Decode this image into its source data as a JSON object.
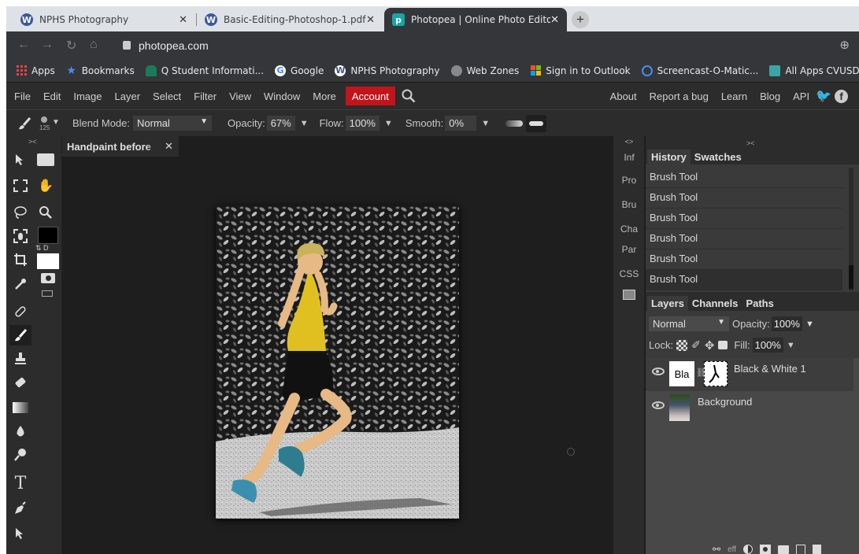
{
  "browser": {
    "tabs": [
      {
        "title": "NPHS Photography",
        "favicon": "W"
      },
      {
        "title": "Basic-Editing-Photoshop-1.pdf",
        "favicon": "W"
      },
      {
        "title": "Photopea | Online Photo Editor",
        "favicon": "p",
        "active": true
      }
    ],
    "new_tab": "+",
    "close": "✕",
    "url": "photopea.com",
    "bookmarks": [
      {
        "label": "Apps",
        "icon": "apps-grid-icon",
        "color": "#e8453c"
      },
      {
        "label": "Bookmarks",
        "icon": "star-icon",
        "color": "#4a8af4"
      },
      {
        "label": "Q Student Informati...",
        "icon": "q-logo-icon",
        "color": "#1c7a5a"
      },
      {
        "label": "Google",
        "icon": "google-icon",
        "color": "#ffffff"
      },
      {
        "label": "NPHS Photography",
        "icon": "wordpress-icon",
        "color": "#ffffff"
      },
      {
        "label": "Web Zones",
        "icon": "globe-icon",
        "color": "#aaaaaa"
      },
      {
        "label": "Sign in to Outlook",
        "icon": "microsoft-icon",
        "color": "#f25022"
      },
      {
        "label": "Screencast-O-Matic...",
        "icon": "screencast-icon",
        "color": "#4a8af4"
      },
      {
        "label": "All Apps CVUSD",
        "icon": "apps-icon",
        "color": "#3aa7a3"
      }
    ]
  },
  "menu": {
    "items": [
      "File",
      "Edit",
      "Image",
      "Layer",
      "Select",
      "Filter",
      "View",
      "Window",
      "More"
    ],
    "account": "Account",
    "right": [
      "About",
      "Report a bug",
      "Learn",
      "Blog",
      "API"
    ]
  },
  "options": {
    "brush_size": "125",
    "blend_label": "Blend Mode:",
    "blend_value": "Normal",
    "opacity_label": "Opacity:",
    "opacity_value": "67%",
    "flow_label": "Flow:",
    "flow_value": "100%",
    "smooth_label": "Smooth:",
    "smooth_value": "0%"
  },
  "document": {
    "tab_title": "Handpaint before",
    "tab_close": "✕"
  },
  "sidebar": {
    "collapse": "<>",
    "items": [
      "Inf",
      "Pro",
      "Bru",
      "Cha",
      "Par",
      "CSS"
    ]
  },
  "history_panel": {
    "collapse": "><",
    "tabs": [
      "History",
      "Swatches"
    ],
    "rows": [
      "Brush Tool",
      "Brush Tool",
      "Brush Tool",
      "Brush Tool",
      "Brush Tool",
      "Brush Tool"
    ]
  },
  "layers_panel": {
    "tabs": [
      "Layers",
      "Channels",
      "Paths"
    ],
    "blend_mode": "Normal",
    "opacity_label": "Opacity:",
    "opacity_value": "100%",
    "lock_label": "Lock:",
    "fill_label": "Fill:",
    "fill_value": "100%",
    "layers": [
      {
        "name": "Black & White 1",
        "thumb_text": "Bla"
      },
      {
        "name": "Background"
      }
    ],
    "footer_effects": "eff"
  },
  "colors": {
    "account_red": "#c2141b",
    "accent_teal": "#18a5a7"
  }
}
